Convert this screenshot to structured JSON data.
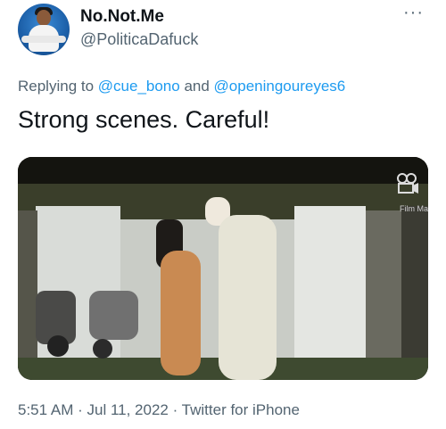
{
  "author": {
    "display_name": "No.Not.Me",
    "handle": "@PoliticaDafuck"
  },
  "more_menu_label": "···",
  "reply_context": {
    "prefix": "Replying to ",
    "mention_1": "@cue_bono",
    "conjunction": " and ",
    "mention_2": "@openingoureyes6"
  },
  "tweet_text": "Strong scenes. Careful!",
  "media": {
    "overlay_label": "Film Ma",
    "icon": "film-camera-icon"
  },
  "meta": {
    "time": "5:51 AM",
    "separator_1": " · ",
    "date": "Jul 11, 2022",
    "separator_2": " · ",
    "client": "Twitter for iPhone"
  },
  "colors": {
    "link": "#1d9bf0",
    "secondary_text": "#536471",
    "primary_text": "#0f1419"
  }
}
